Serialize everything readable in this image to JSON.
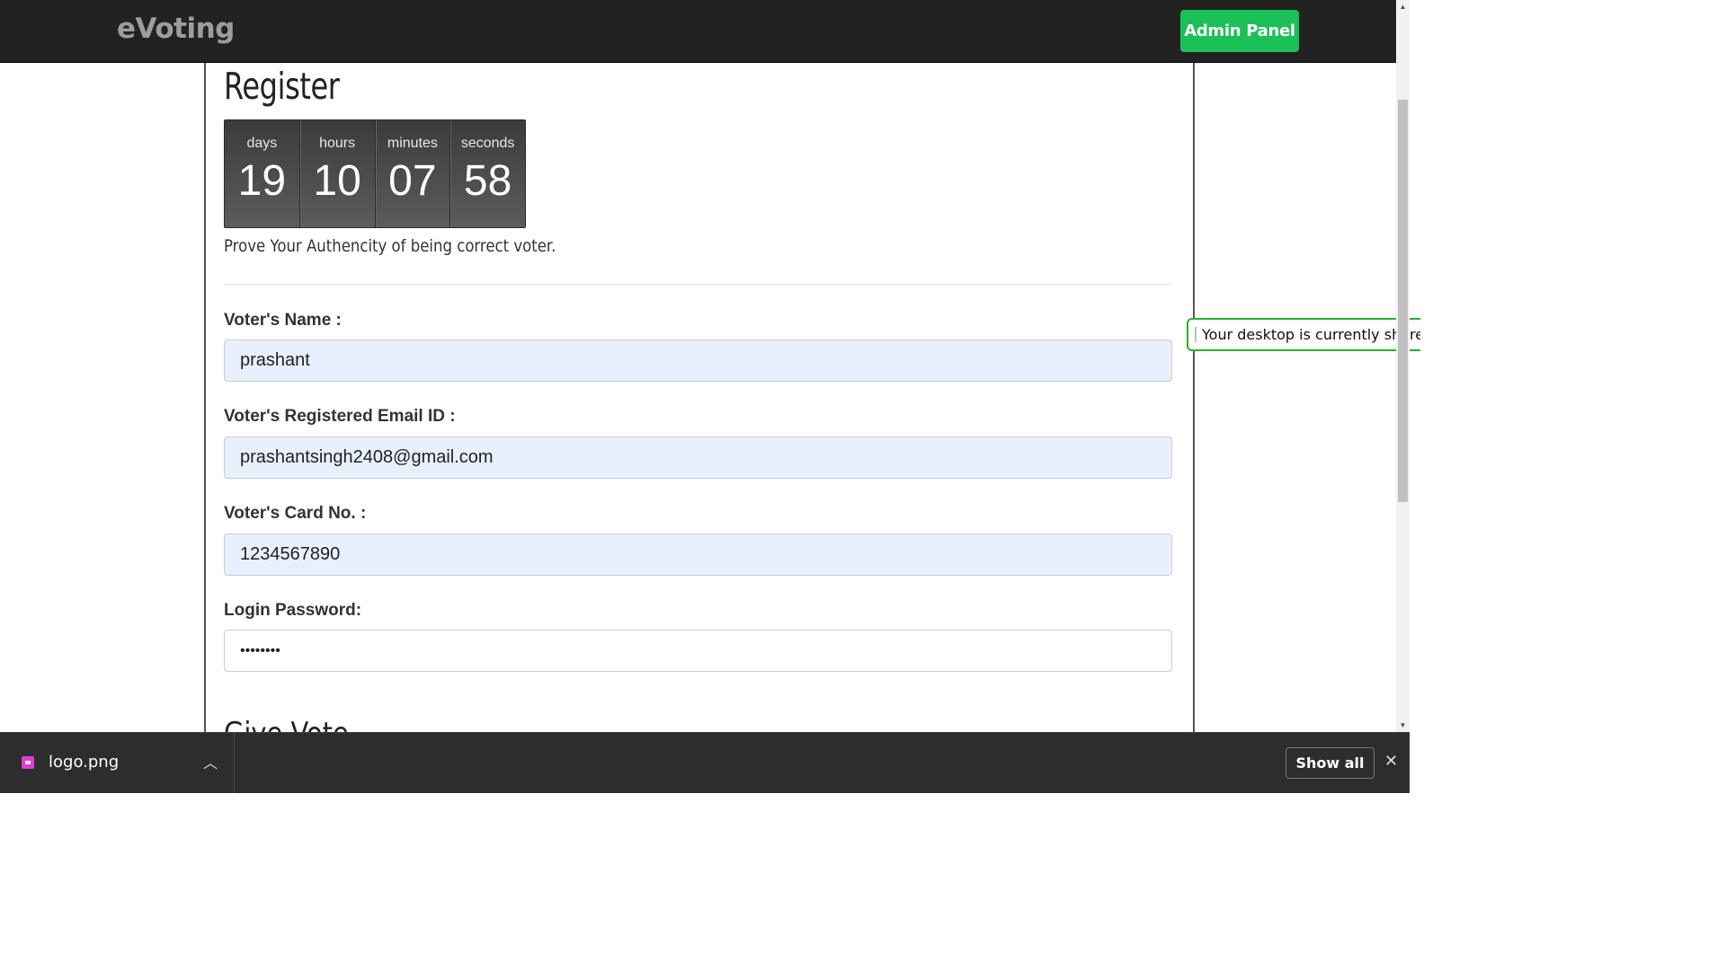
{
  "navbar": {
    "brand": "eVoting",
    "admin_button": "Admin Panel"
  },
  "page": {
    "title": "Register",
    "subtitle": "Prove Your Authencity of being correct voter.",
    "next_section_title": "Give Vote"
  },
  "countdown": {
    "days_label": "days",
    "days": "19",
    "hours_label": "hours",
    "hours": "10",
    "minutes_label": "minutes",
    "minutes": "07",
    "seconds_label": "seconds",
    "seconds": "58"
  },
  "form": {
    "name_label": "Voter's Name :",
    "name_value": "prashant",
    "email_label": "Voter's Registered Email ID :",
    "email_value": "prashantsingh2408@gmail.com",
    "card_label": "Voter's Card No. :",
    "card_value": "1234567890",
    "password_label": "Login Password:",
    "password_value": "••••••••"
  },
  "share_banner": {
    "text": "Your desktop is currently shared"
  },
  "download_bar": {
    "file_name": "logo.png",
    "show_all": "Show all"
  },
  "colors": {
    "navbar_bg": "#222222",
    "admin_button_bg": "#1bc057",
    "autofill_bg": "#e8f0fe",
    "share_border": "#2bb12b",
    "file_icon": "#e23bd3"
  }
}
